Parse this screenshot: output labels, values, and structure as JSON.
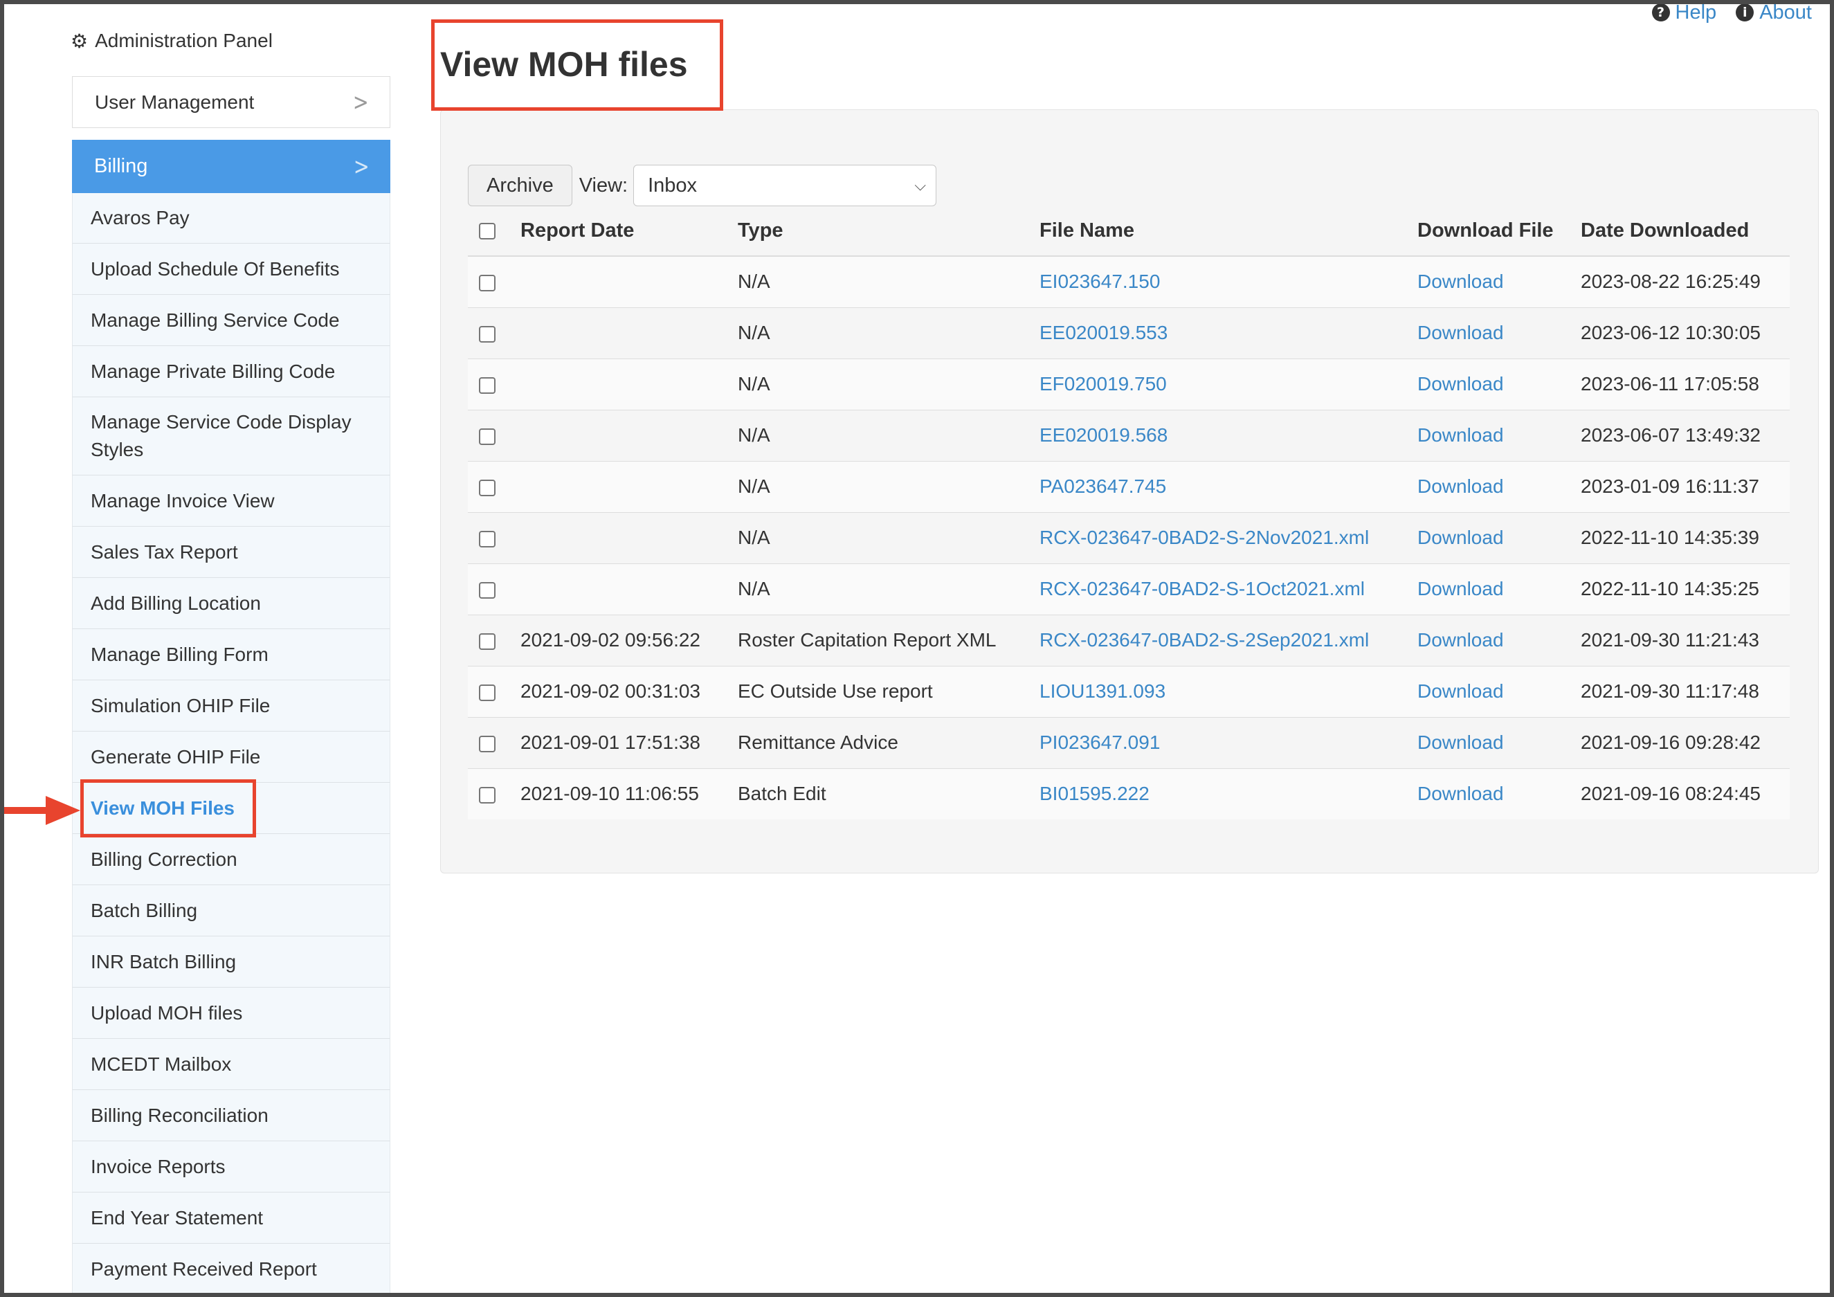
{
  "top_links": {
    "help": "Help",
    "about": "About"
  },
  "sidebar": {
    "header": "Administration Panel",
    "user_management": "User Management",
    "billing": "Billing",
    "items": [
      "Avaros Pay",
      "Upload Schedule Of Benefits",
      "Manage Billing Service Code",
      "Manage Private Billing Code",
      "Manage Service Code Display Styles",
      "Manage Invoice View",
      "Sales Tax Report",
      "Add Billing Location",
      "Manage Billing Form",
      "Simulation OHIP File",
      "Generate OHIP File",
      "View MOH Files",
      "Billing Correction",
      "Batch Billing",
      "INR Batch Billing",
      "Upload MOH files",
      "MCEDT Mailbox",
      "Billing Reconciliation",
      "Invoice Reports",
      "End Year Statement",
      "Payment Received Report"
    ],
    "selected_item": "View MOH Files"
  },
  "main": {
    "title": "View MOH files",
    "archive_button": "Archive",
    "view_label": "View:",
    "view_selected": "Inbox",
    "columns": [
      "Report Date",
      "Type",
      "File Name",
      "Download File",
      "Date Downloaded"
    ],
    "rows": [
      {
        "report_date": "",
        "type": "N/A",
        "file_name": "EI023647.150",
        "download": "Download",
        "date_downloaded": "2023-08-22 16:25:49"
      },
      {
        "report_date": "",
        "type": "N/A",
        "file_name": "EE020019.553",
        "download": "Download",
        "date_downloaded": "2023-06-12 10:30:05"
      },
      {
        "report_date": "",
        "type": "N/A",
        "file_name": "EF020019.750",
        "download": "Download",
        "date_downloaded": "2023-06-11 17:05:58"
      },
      {
        "report_date": "",
        "type": "N/A",
        "file_name": "EE020019.568",
        "download": "Download",
        "date_downloaded": "2023-06-07 13:49:32"
      },
      {
        "report_date": "",
        "type": "N/A",
        "file_name": "PA023647.745",
        "download": "Download",
        "date_downloaded": "2023-01-09 16:11:37"
      },
      {
        "report_date": "",
        "type": "N/A",
        "file_name": "RCX-023647-0BAD2-S-2Nov2021.xml",
        "download": "Download",
        "date_downloaded": "2022-11-10 14:35:39"
      },
      {
        "report_date": "",
        "type": "N/A",
        "file_name": "RCX-023647-0BAD2-S-1Oct2021.xml",
        "download": "Download",
        "date_downloaded": "2022-11-10 14:35:25"
      },
      {
        "report_date": "2021-09-02 09:56:22",
        "type": "Roster Capitation Report XML",
        "file_name": "RCX-023647-0BAD2-S-2Sep2021.xml",
        "download": "Download",
        "date_downloaded": "2021-09-30 11:21:43"
      },
      {
        "report_date": "2021-09-02 00:31:03",
        "type": "EC Outside Use report",
        "file_name": "LIOU1391.093",
        "download": "Download",
        "date_downloaded": "2021-09-30 11:17:48"
      },
      {
        "report_date": "2021-09-01 17:51:38",
        "type": "Remittance Advice",
        "file_name": "PI023647.091",
        "download": "Download",
        "date_downloaded": "2021-09-16 09:28:42"
      },
      {
        "report_date": "2021-09-10 11:06:55",
        "type": "Batch Edit",
        "file_name": "BI01595.222",
        "download": "Download",
        "date_downloaded": "2021-09-16 08:24:45"
      }
    ]
  },
  "icons": {
    "help": "question-circle-icon",
    "about": "info-circle-icon",
    "header": "gear-icon",
    "chevron": "chevron-right-icon",
    "select": "chevron-down-icon"
  },
  "colors": {
    "accent": "#4a9ae6",
    "link": "#3a87c7",
    "annotation": "#e8442e"
  }
}
